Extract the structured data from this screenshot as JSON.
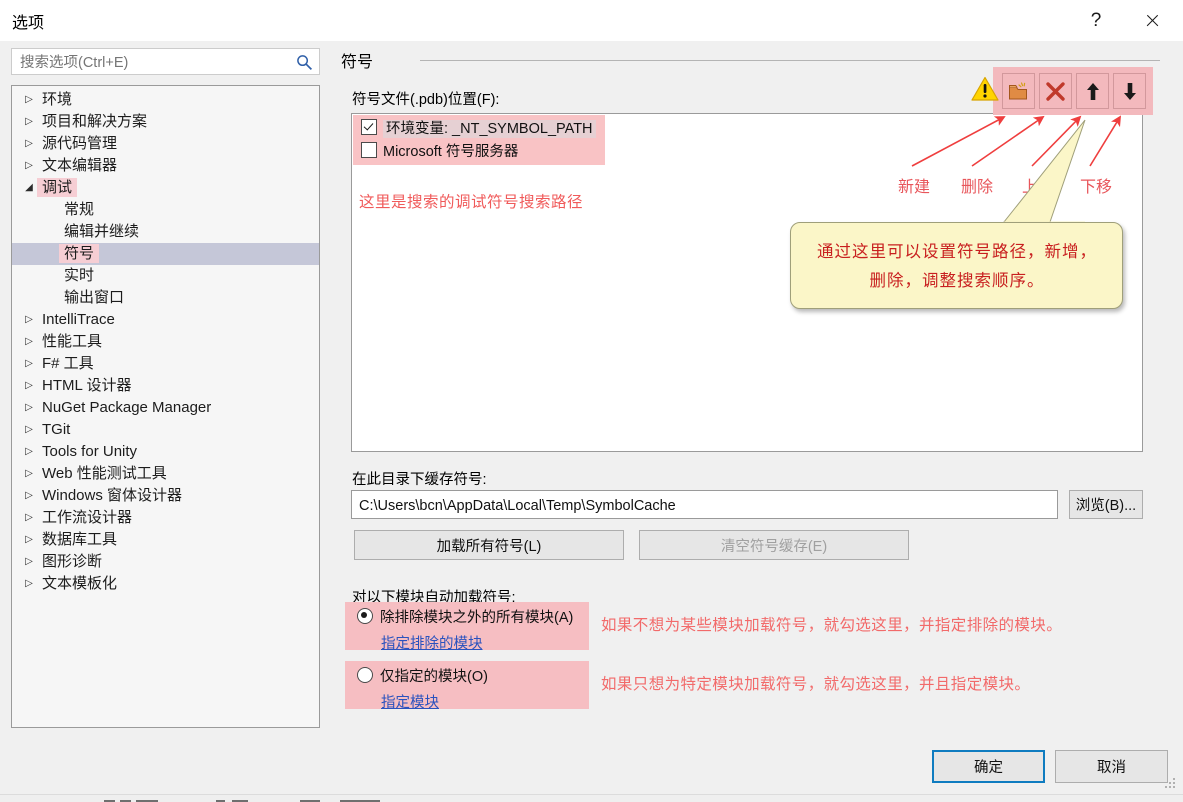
{
  "window": {
    "title": "选项",
    "help_label": "?",
    "close_label": "×"
  },
  "search": {
    "placeholder": "搜索选项(Ctrl+E)",
    "value": "",
    "icon": "search-icon"
  },
  "tree": {
    "items": [
      {
        "label": "环境",
        "level": 0,
        "expanded": false,
        "selected": false,
        "highlight": false
      },
      {
        "label": "项目和解决方案",
        "level": 0,
        "expanded": false,
        "selected": false,
        "highlight": false
      },
      {
        "label": "源代码管理",
        "level": 0,
        "expanded": false,
        "selected": false,
        "highlight": false
      },
      {
        "label": "文本编辑器",
        "level": 0,
        "expanded": false,
        "selected": false,
        "highlight": false
      },
      {
        "label": "调试",
        "level": 0,
        "expanded": true,
        "selected": false,
        "highlight": true
      },
      {
        "label": "常规",
        "level": 1,
        "expanded": null,
        "selected": false,
        "highlight": false
      },
      {
        "label": "编辑并继续",
        "level": 1,
        "expanded": null,
        "selected": false,
        "highlight": false
      },
      {
        "label": "符号",
        "level": 1,
        "expanded": null,
        "selected": true,
        "highlight": true
      },
      {
        "label": "实时",
        "level": 1,
        "expanded": null,
        "selected": false,
        "highlight": false
      },
      {
        "label": "输出窗口",
        "level": 1,
        "expanded": null,
        "selected": false,
        "highlight": false
      },
      {
        "label": "IntelliTrace",
        "level": 0,
        "expanded": false,
        "selected": false,
        "highlight": false
      },
      {
        "label": "性能工具",
        "level": 0,
        "expanded": false,
        "selected": false,
        "highlight": false
      },
      {
        "label": "F# 工具",
        "level": 0,
        "expanded": false,
        "selected": false,
        "highlight": false
      },
      {
        "label": "HTML 设计器",
        "level": 0,
        "expanded": false,
        "selected": false,
        "highlight": false
      },
      {
        "label": "NuGet Package Manager",
        "level": 0,
        "expanded": false,
        "selected": false,
        "highlight": false
      },
      {
        "label": "TGit",
        "level": 0,
        "expanded": false,
        "selected": false,
        "highlight": false
      },
      {
        "label": "Tools for Unity",
        "level": 0,
        "expanded": false,
        "selected": false,
        "highlight": false
      },
      {
        "label": "Web 性能测试工具",
        "level": 0,
        "expanded": false,
        "selected": false,
        "highlight": false
      },
      {
        "label": "Windows 窗体设计器",
        "level": 0,
        "expanded": false,
        "selected": false,
        "highlight": false
      },
      {
        "label": "工作流设计器",
        "level": 0,
        "expanded": false,
        "selected": false,
        "highlight": false
      },
      {
        "label": "数据库工具",
        "level": 0,
        "expanded": false,
        "selected": false,
        "highlight": false
      },
      {
        "label": "图形诊断",
        "level": 0,
        "expanded": false,
        "selected": false,
        "highlight": false
      },
      {
        "label": "文本模板化",
        "level": 0,
        "expanded": false,
        "selected": false,
        "highlight": false
      }
    ],
    "collapsed_glyph": "▷",
    "expanded_glyph": "◢"
  },
  "pane": {
    "title": "符号",
    "symbol_files_label": "符号文件(.pdb)位置(F):",
    "cache_label": "在此目录下缓存符号:",
    "auto_load_label": "对以下模块自动加载符号:"
  },
  "symbol_paths": {
    "entries": [
      {
        "label": "环境变量:  _NT_SYMBOL_PATH",
        "checked": true
      },
      {
        "label": "Microsoft 符号服务器",
        "checked": false
      }
    ],
    "note": "这里是搜索的调试符号搜索路径"
  },
  "toolbar": {
    "buttons": [
      {
        "name": "new-folder",
        "label": "新建",
        "icon": "new-folder-icon"
      },
      {
        "name": "delete",
        "label": "删除",
        "icon": "delete-x-icon"
      },
      {
        "name": "move-up",
        "label": "上移",
        "icon": "arrow-up-icon"
      },
      {
        "name": "move-down",
        "label": "下移",
        "icon": "arrow-down-icon"
      }
    ],
    "warning_icon": "warning-triangle-icon"
  },
  "callout": {
    "text": "通过这里可以设置符号路径，新增，删除，调整搜索顺序。"
  },
  "cache": {
    "path": "C:\\Users\\bcn\\AppData\\Local\\Temp\\SymbolCache",
    "browse_label": "浏览(B)...",
    "load_all_label": "加载所有符号(L)",
    "clear_cache_label": "清空符号缓存(E)",
    "clear_cache_disabled": true
  },
  "auto_load": {
    "options": [
      {
        "label": "除排除模块之外的所有模块(A)",
        "selected": true,
        "link": "指定排除的模块",
        "annotation": "如果不想为某些模块加载符号，就勾选这里，并指定排除的模块。"
      },
      {
        "label": "仅指定的模块(O)",
        "selected": false,
        "link": "指定模块",
        "annotation": "如果只想为特定模块加载符号，就勾选这里，并且指定模块。"
      }
    ]
  },
  "footer": {
    "ok_label": "确定",
    "cancel_label": "取消"
  },
  "colors": {
    "highlight_pink": "#f6bec2",
    "annotation_red": "#f26a6a",
    "callout_bg": "#fbf6c8",
    "callout_text": "#c81f1f",
    "selection_blue": "#c5c7d8",
    "focus_blue": "#0f7cc0",
    "link_blue": "#2a52be"
  }
}
